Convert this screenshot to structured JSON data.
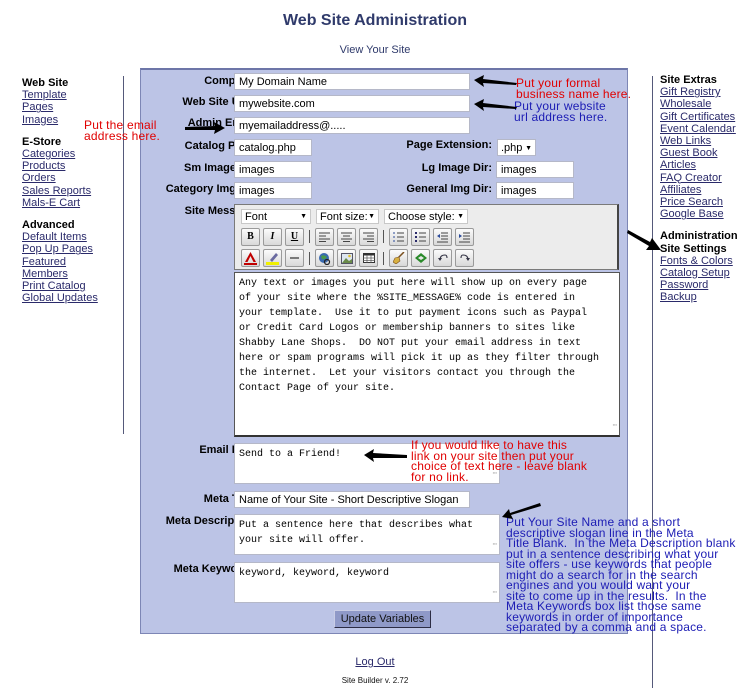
{
  "header": {
    "title": "Web Site Administration",
    "view_site_link": "View Your Site"
  },
  "left_nav": {
    "sections": [
      {
        "title": "Web Site",
        "items": [
          "Template",
          "Pages",
          "Images"
        ]
      },
      {
        "title": "E-Store",
        "items": [
          "Categories",
          "Products",
          "Orders",
          "Sales Reports",
          "Mals-E Cart"
        ]
      },
      {
        "title": "Advanced",
        "items": [
          "Default Items",
          "Pop Up Pages",
          "Featured",
          "Members",
          "Print Catalog",
          "Global Updates"
        ]
      }
    ]
  },
  "right_nav": {
    "sections": [
      {
        "title": "Site Extras",
        "items": [
          "Gift Registry",
          "Wholesale",
          "Gift Certificates",
          "Event Calendar",
          "Web Links",
          "Guest Book",
          "Articles",
          "FAQ Creator",
          "Affiliates",
          "Price Search",
          "Google Base"
        ]
      },
      {
        "title": "Administration",
        "active_item": "Site Settings",
        "items": [
          "Fonts & Colors",
          "Catalog Setup",
          "Password",
          "Backup"
        ]
      }
    ]
  },
  "form": {
    "company": {
      "label": "Company:",
      "value": "My Domain Name"
    },
    "website_url": {
      "label": "Web Site URL:",
      "value": "mywebsite.com"
    },
    "admin_email": {
      "label": "Admin Email:",
      "value": "myemailaddress@....."
    },
    "catalog_page": {
      "label": "Catalog Page:",
      "value": "catalog.php"
    },
    "page_extension": {
      "label": "Page Extension:",
      "value": ".php"
    },
    "sm_image_dir": {
      "label": "Sm Image Dir:",
      "value": "images"
    },
    "lg_image_dir": {
      "label": "Lg Image Dir:",
      "value": "images"
    },
    "category_img_dir": {
      "label": "Category Img Dir:",
      "value": "images"
    },
    "general_img_dir": {
      "label": "General Img Dir:",
      "value": "images"
    },
    "site_message": {
      "label": "Site Message:",
      "value": "Any text or images you put here will show up on every page\nof your site where the %SITE_MESSAGE% code is entered in\nyour template.  Use it to put payment icons such as Paypal\nor Credit Card Logos or membership banners to sites like\nShabby Lane Shops.  DO NOT put your email address in text\nhere or spam programs will pick it up as they filter through\nthe internet.  Let your visitors contact you through the\nContact Page of your site."
    },
    "email_link": {
      "label": "Email Link:",
      "value": "Send to a Friend!"
    },
    "meta_title": {
      "label": "Meta Title:",
      "value": "Name of Your Site - Short Descriptive Slogan"
    },
    "meta_description": {
      "label": "Meta Description:",
      "value": "Put a sentence here that describes what\nyour site will offer."
    },
    "meta_keywords": {
      "label": "Meta Keywords:",
      "value": "keyword, keyword, keyword"
    },
    "submit_label": "Update Variables"
  },
  "editor_toolbar": {
    "font_select": "Font",
    "font_size_select": "Font size:",
    "style_select": "Choose style:",
    "buttons_row1": [
      "bold",
      "italic",
      "underline",
      "align-left",
      "align-center",
      "align-right",
      "ordered-list",
      "unordered-list",
      "outdent",
      "indent"
    ],
    "buttons_row2": [
      "font-color",
      "highlight",
      "horizontal-rule",
      "insert-link",
      "insert-image",
      "insert-table",
      "clean-format",
      "view-source",
      "undo",
      "redo"
    ],
    "glyphs": {
      "bold": "B",
      "italic": "I",
      "underline": "U"
    }
  },
  "annotations": {
    "company": "Put your formal\nbusiness name here.",
    "url": "Put your website\nurl address here.",
    "email": "Put the email\naddress here.",
    "email_link": "If you would like to have this\nlink on your site then put your\nchoice of text here - leave blank\nfor no link.",
    "meta": "Put Your Site Name and a short\ndescriptive slogan line in the Meta\nTitle Blank.  In the Meta Description blank\nput in a sentence describing what your\nsite offers - use keywords that people\nmight do a search for in the search\nengines and you would want your\nsite to come up in the results.  In the\nMeta Keywords box list those same\nkeywords in order of importance\nseparated by a comma and a space.",
    "colors": {
      "red": "#e00000",
      "blue": "#1c1cb4"
    }
  },
  "footer": {
    "logout": "Log Out",
    "version": "Site Builder v. 2.72"
  }
}
